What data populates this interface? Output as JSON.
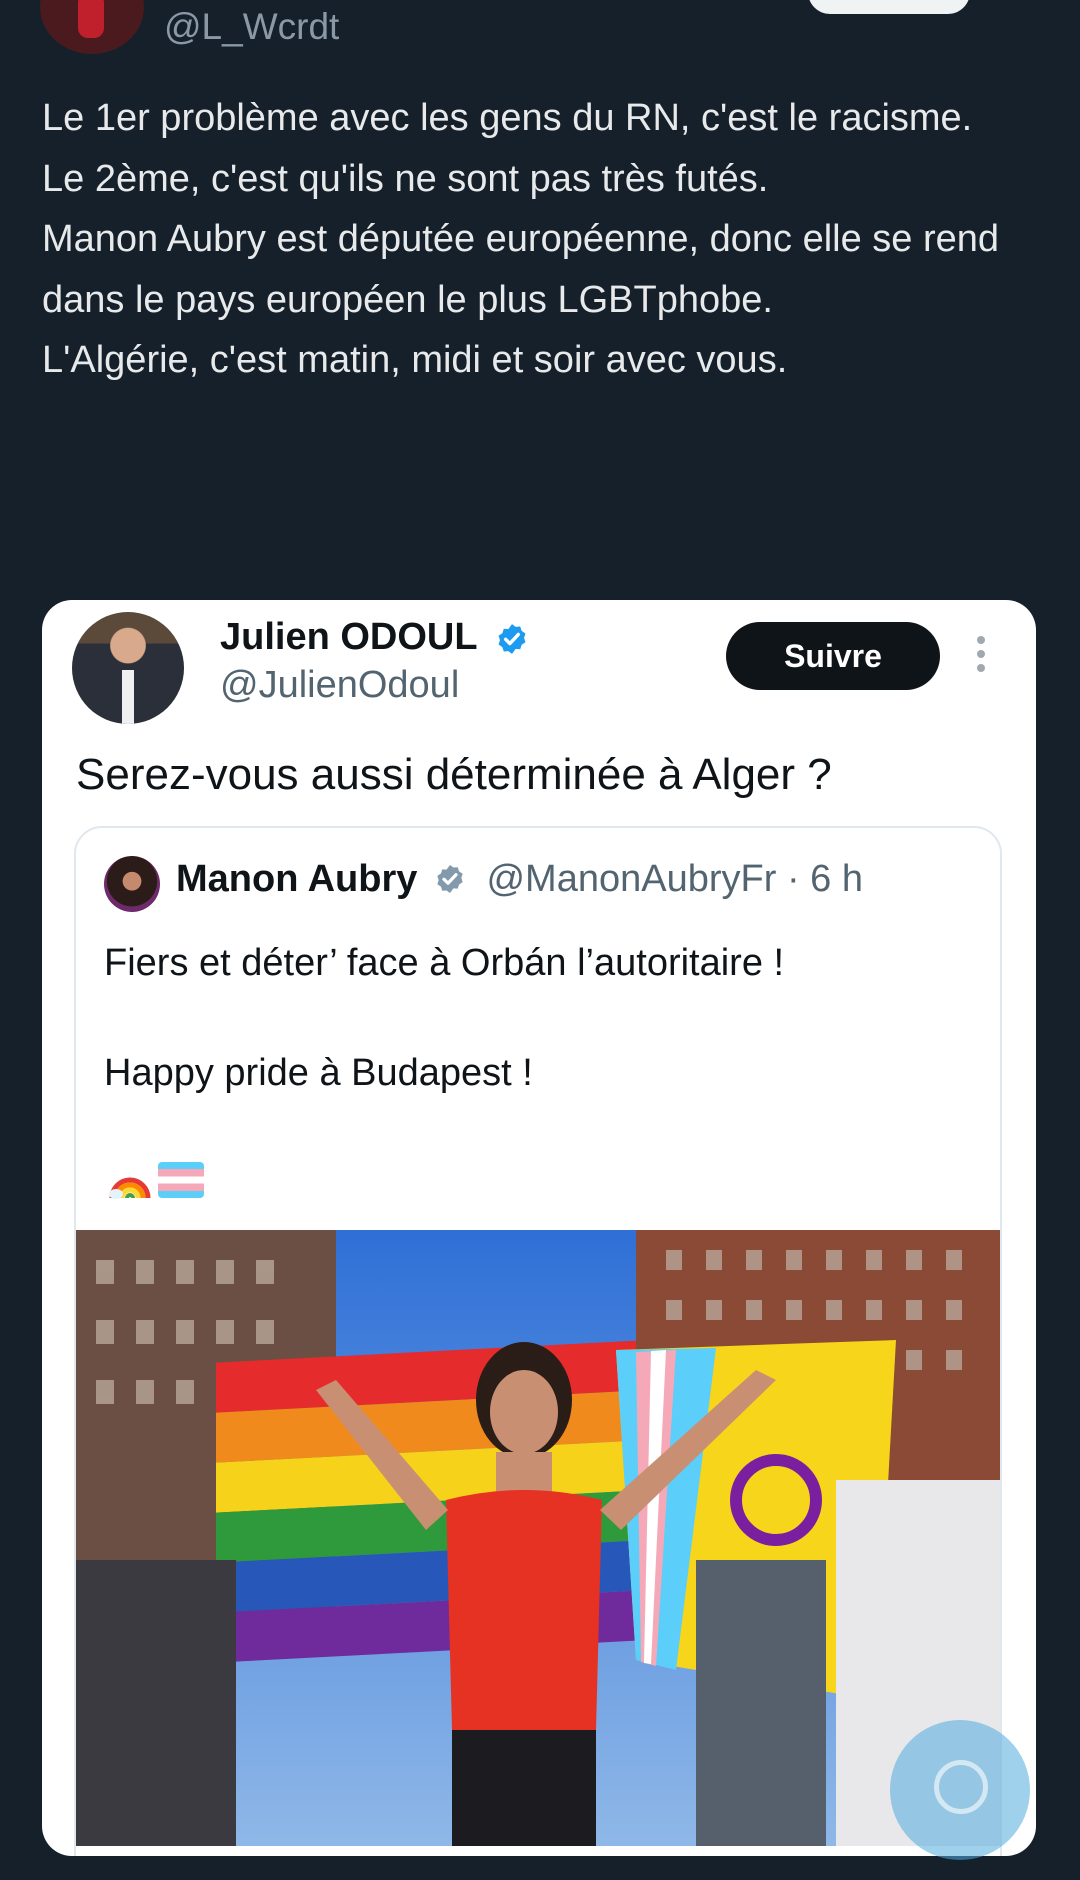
{
  "tweet": {
    "handle": "@L_Wcrdt",
    "lines": [
      "Le 1er problème avec les gens du RN, c'est le racisme.",
      "Le 2ème, c'est qu'ils ne sont pas très futés.",
      "",
      "Manon Aubry est députée européenne, donc elle se rend dans le pays européen le plus LGBTphobe.",
      "",
      "L'Algérie, c'est matin, midi et soir avec vous."
    ]
  },
  "embed": {
    "name": "Julien ODOUL",
    "handle": "@JulienOdoul",
    "follow_label": "Suivre",
    "text": "Serez-vous aussi déterminée à Alger ?",
    "quote": {
      "name": "Manon Aubry",
      "handle": "@ManonAubryFr",
      "time": "· 6 h",
      "lines": [
        "Fiers et déter’ face à Orbán l’autoritaire !",
        "",
        "Happy pride à Budapest !"
      ],
      "emojis": [
        "rainbow-emoji",
        "transgender-flag-emoji"
      ]
    }
  },
  "colors": {
    "background": "#15202b",
    "text": "#e7e9ea",
    "muted": "#8b98a5",
    "verified": "#1d9bf0",
    "card_bg": "#ffffff",
    "button_bg": "#0f1419"
  },
  "icons": {
    "verified": "verified-badge-icon",
    "gray_verified": "gray-verified-badge-icon",
    "more": "more-vertical-icon",
    "help": "help-bubble-icon"
  }
}
